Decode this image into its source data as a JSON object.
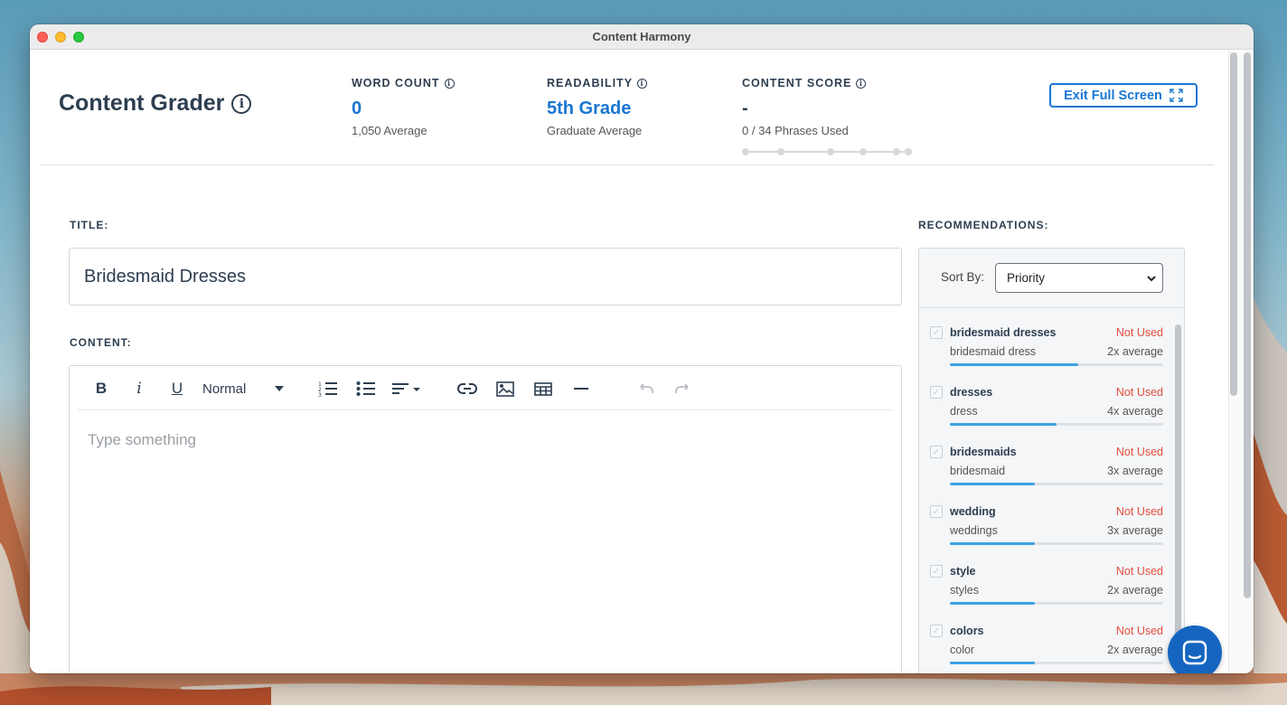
{
  "window": {
    "title": "Content Harmony"
  },
  "header": {
    "app_title": "Content Grader",
    "word_count": {
      "label": "WORD COUNT",
      "value": "0",
      "sub": "1,050 Average"
    },
    "readability": {
      "label": "READABILITY",
      "value": "5th Grade",
      "sub": "Graduate Average"
    },
    "content_score": {
      "label": "CONTENT SCORE",
      "value": "-",
      "sub": "0 / 34 Phrases Used"
    },
    "exit_button": "Exit Full Screen"
  },
  "form": {
    "title_label": "TITLE:",
    "title_value": "Bridesmaid Dresses",
    "content_label": "CONTENT:",
    "content_placeholder": "Type something",
    "toolbar": {
      "bold": "B",
      "italic": "i",
      "underline": "U",
      "format_select": "Normal"
    }
  },
  "recommendations": {
    "label": "RECOMMENDATIONS:",
    "sort_label": "Sort By:",
    "sort_value": "Priority",
    "items": [
      {
        "phrase": "bridesmaid dresses",
        "status": "Not Used",
        "variant": "bridesmaid dress",
        "average": "2x average",
        "fill": 0.6
      },
      {
        "phrase": "dresses",
        "status": "Not Used",
        "variant": "dress",
        "average": "4x average",
        "fill": 0.5
      },
      {
        "phrase": "bridesmaids",
        "status": "Not Used",
        "variant": "bridesmaid",
        "average": "3x average",
        "fill": 0.4
      },
      {
        "phrase": "wedding",
        "status": "Not Used",
        "variant": "weddings",
        "average": "3x average",
        "fill": 0.4
      },
      {
        "phrase": "style",
        "status": "Not Used",
        "variant": "styles",
        "average": "2x average",
        "fill": 0.4
      },
      {
        "phrase": "colors",
        "status": "Not Used",
        "variant": "color",
        "average": "2x average",
        "fill": 0.4
      }
    ]
  },
  "colors": {
    "accent": "#1976d2",
    "status_not_used": "#e74c3c",
    "progress": "#3ea1e6"
  }
}
